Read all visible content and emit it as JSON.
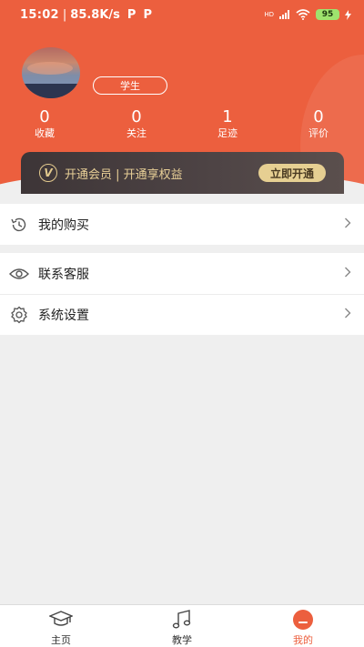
{
  "status_bar": {
    "time": "15:02",
    "network_speed": "85.8K/s",
    "app_badges": [
      "P",
      "P"
    ],
    "signal_label": "HD",
    "battery": "95"
  },
  "profile": {
    "avatar_icon": "avatar-photo",
    "role": "学生"
  },
  "stats": [
    {
      "value": "0",
      "label": "收藏"
    },
    {
      "value": "0",
      "label": "关注"
    },
    {
      "value": "1",
      "label": "足迹"
    },
    {
      "value": "0",
      "label": "评价"
    }
  ],
  "vip": {
    "text": "开通会员 | 开通享权益",
    "button": "立即开通",
    "colors": {
      "gold": "#e6cf92",
      "bar": "#4a4143"
    }
  },
  "menu": {
    "purchases": {
      "label": "我的购买",
      "icon": "history-icon"
    },
    "support": {
      "label": "联系客服",
      "icon": "eye-icon"
    },
    "settings": {
      "label": "系统设置",
      "icon": "gear-icon"
    }
  },
  "tabs": [
    {
      "label": "主页",
      "icon": "graduation-cap-icon",
      "active": false
    },
    {
      "label": "教学",
      "icon": "music-note-icon",
      "active": false
    },
    {
      "label": "我的",
      "icon": "profile-icon",
      "active": true
    }
  ],
  "colors": {
    "accent": "#ec5f3e",
    "background": "#efefef"
  }
}
